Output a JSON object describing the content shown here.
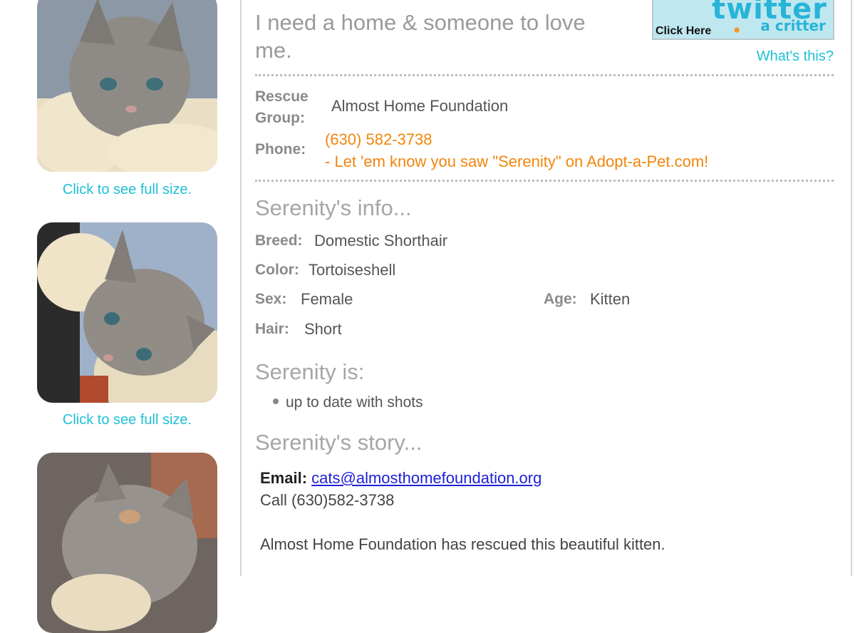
{
  "photos": {
    "captions": [
      "Click to see full size.",
      "Click to see full size."
    ]
  },
  "header": {
    "tagline": "I need a home & someone to love me.",
    "twitter_badge": {
      "click_here": "Click Here",
      "word": "twitter",
      "sub": "a critter"
    },
    "whats_this": "What's this?"
  },
  "contact": {
    "rescue_group_label_1": "Rescue",
    "rescue_group_label_2": "Group:",
    "rescue_group_value": "Almost Home Foundation",
    "phone_label": "Phone:",
    "phone_value": "(630) 582-3738",
    "phone_note": "- Let 'em know you saw \"Serenity\" on Adopt-a-Pet.com!"
  },
  "info": {
    "heading": "Serenity's info...",
    "breed_label": "Breed:",
    "breed_value": "Domestic Shorthair",
    "color_label": "Color:",
    "color_value": "Tortoiseshell",
    "sex_label": "Sex:",
    "sex_value": "Female",
    "age_label": "Age:",
    "age_value": "Kitten",
    "hair_label": "Hair:",
    "hair_value": "Short"
  },
  "is": {
    "heading": "Serenity is:",
    "items": [
      "up to date with shots"
    ]
  },
  "story": {
    "heading": "Serenity's story...",
    "email_label": "Email:",
    "email_value": "cats@almosthomefoundation.org",
    "call_line": "Call (630)582-3738",
    "paragraph": "Almost Home Foundation has rescued this beautiful kitten."
  },
  "colors": {
    "accent_cyan": "#1fc0d6",
    "phone_orange": "#f0860d",
    "link_blue": "#2020d8"
  }
}
